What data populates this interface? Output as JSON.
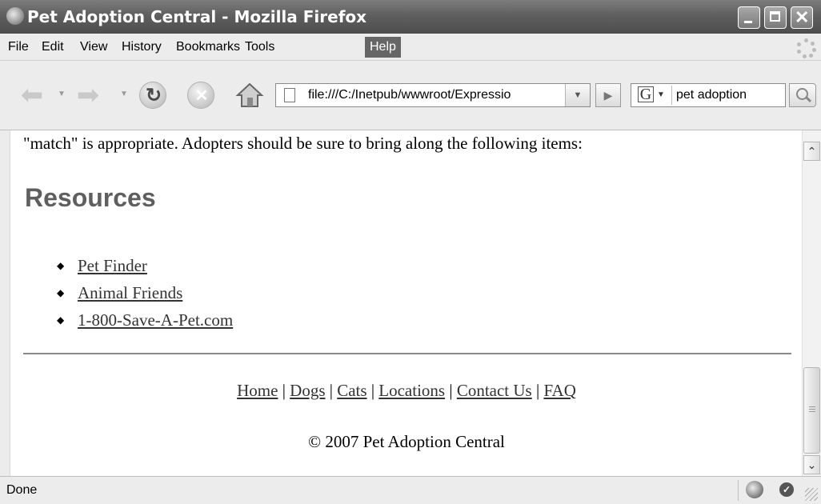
{
  "window": {
    "title": "Pet Adoption Central - Mozilla Firefox"
  },
  "menu": {
    "items": [
      {
        "label": "File"
      },
      {
        "label": "Edit"
      },
      {
        "label": "View"
      },
      {
        "label": "History"
      },
      {
        "label": "Bookmarks"
      },
      {
        "label": "Tools"
      },
      {
        "label": "Help",
        "active": true
      }
    ]
  },
  "toolbar": {
    "url": "file:///C:/Inetpub/wwwroot/Expressio",
    "search_text": "pet adoption",
    "search_engine_icon": "G"
  },
  "page": {
    "intro": "\"match\" is appropriate. Adopters should be sure to bring along the following items:",
    "resources_heading": "Resources",
    "resources": [
      {
        "label": "Pet Finder"
      },
      {
        "label": "Animal Friends"
      },
      {
        "label": "1-800-Save-A-Pet.com"
      }
    ],
    "footer_links": [
      {
        "label": "Home"
      },
      {
        "label": "Dogs"
      },
      {
        "label": "Cats"
      },
      {
        "label": "Locations"
      },
      {
        "label": "Contact Us"
      },
      {
        "label": "FAQ"
      }
    ],
    "footer_separator": "|",
    "copyright": "© 2007 Pet Adoption Central"
  },
  "status": {
    "text": "Done"
  },
  "colors": {
    "titlebar": "#5f5f5f",
    "menu_active": "#666666",
    "heading": "#5f5f5f",
    "link": "#333333"
  }
}
